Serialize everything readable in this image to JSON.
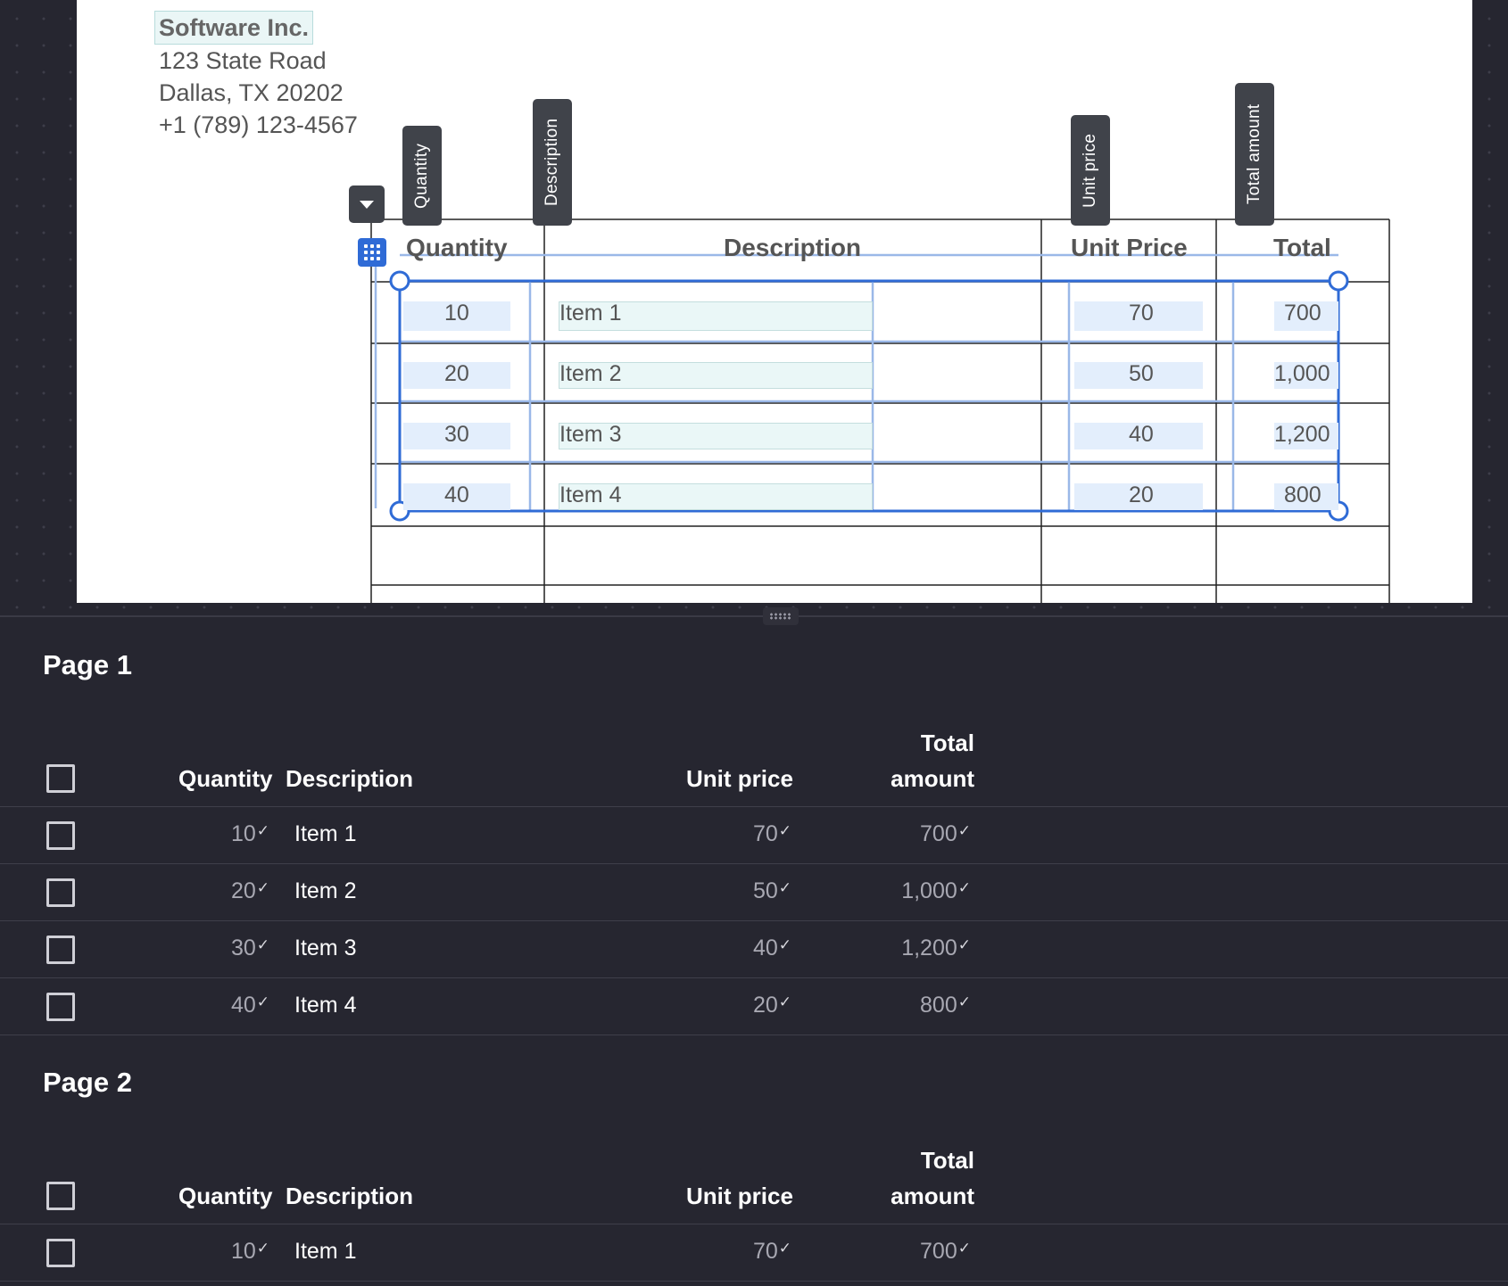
{
  "document": {
    "company": {
      "name": "Software Inc.",
      "address1": "123 State Road",
      "address2": "Dallas, TX 20202",
      "phone": "+1 (789) 123-4567"
    },
    "column_tags": [
      "Quantity",
      "Description",
      "Unit price",
      "Total amount"
    ],
    "table_headers": [
      "Quantity",
      "Description",
      "Unit Price",
      "Total"
    ],
    "rows": [
      {
        "quantity": "10",
        "description": "Item 1",
        "unit_price": "70",
        "total": "700"
      },
      {
        "quantity": "20",
        "description": "Item 2",
        "unit_price": "50",
        "total": "1,000"
      },
      {
        "quantity": "30",
        "description": "Item 3",
        "unit_price": "40",
        "total": "1,200"
      },
      {
        "quantity": "40",
        "description": "Item 4",
        "unit_price": "20",
        "total": "800"
      }
    ],
    "accent_color": "#2f6bd6"
  },
  "results": {
    "headers": {
      "quantity": "Quantity",
      "description": "Description",
      "unit_price": "Unit price",
      "total_line1": "Total",
      "total_line2": "amount"
    },
    "check_mark": "✓",
    "pages": [
      {
        "title": "Page 1",
        "rows": [
          {
            "quantity": "10",
            "description": "Item 1",
            "unit_price": "70",
            "total": "700"
          },
          {
            "quantity": "20",
            "description": "Item 2",
            "unit_price": "50",
            "total": "1,000"
          },
          {
            "quantity": "30",
            "description": "Item 3",
            "unit_price": "40",
            "total": "1,200"
          },
          {
            "quantity": "40",
            "description": "Item 4",
            "unit_price": "20",
            "total": "800"
          }
        ]
      },
      {
        "title": "Page 2",
        "rows": [
          {
            "quantity": "10",
            "description": "Item 1",
            "unit_price": "70",
            "total": "700"
          }
        ]
      }
    ]
  }
}
